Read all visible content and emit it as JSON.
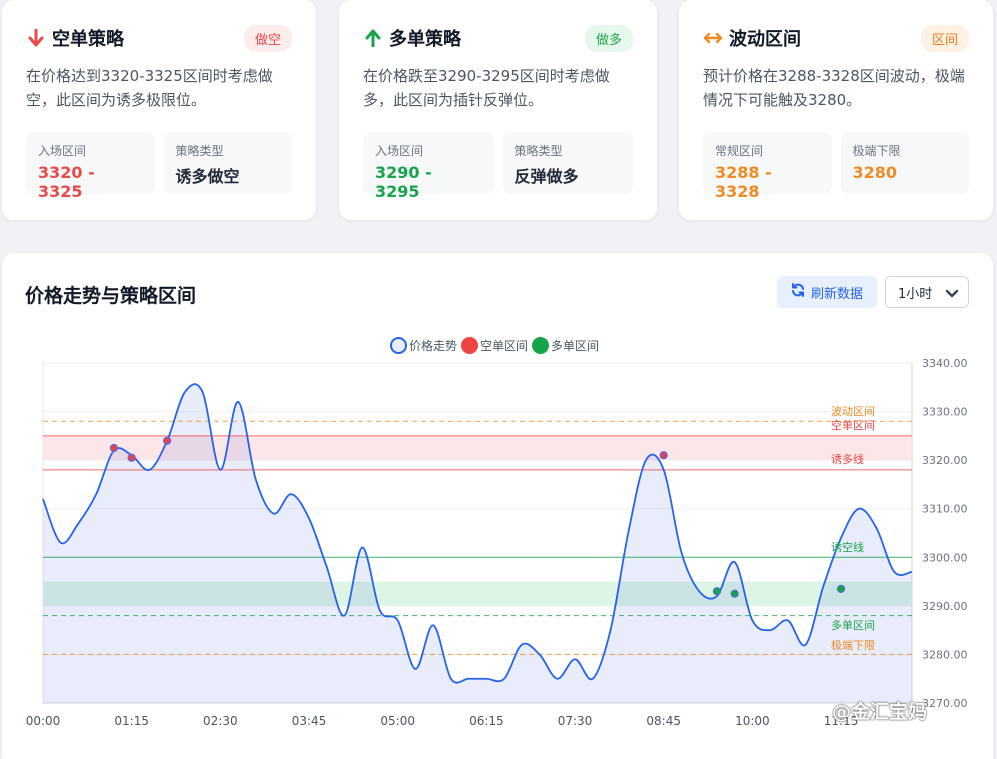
{
  "cards": [
    {
      "title": "空单策略",
      "badge": "做空",
      "badge_bg": "#fdecec",
      "badge_color": "#e84a4a",
      "accent": "#e84a4a",
      "icon": "arrow-down-icon",
      "desc": "在价格达到3320-3325区间时考虑做空，此区间为诱多极限位。",
      "box1_label": "入场区间",
      "box1_value": "3320 - 3325",
      "box2_label": "策略类型",
      "box2_value": "诱多做空"
    },
    {
      "title": "多单策略",
      "badge": "做多",
      "badge_bg": "#e6f7eb",
      "badge_color": "#22a84a",
      "accent": "#16a34a",
      "icon": "arrow-up-icon",
      "desc": "在价格跌至3290-3295区间时考虑做多，此区间为插针反弹位。",
      "box1_label": "入场区间",
      "box1_value": "3290 - 3295",
      "box2_label": "策略类型",
      "box2_value": "反弹做多"
    },
    {
      "title": "波动区间",
      "badge": "区间",
      "badge_bg": "#fff1e3",
      "badge_color": "#ef7d1a",
      "accent": "#f08a24",
      "icon": "arrows-left-right-icon",
      "desc": "预计价格在3288-3328区间波动，极端情况下可能触及3280。",
      "box1_label": "常规区间",
      "box1_value": "3288 - 3328",
      "box2_label": "极端下限",
      "box2_value": "3280"
    }
  ],
  "chart_panel": {
    "title": "价格走势与策略区间",
    "refresh_label": "刷新数据",
    "interval_selected": "1小时"
  },
  "chart_data": {
    "type": "line",
    "legend": [
      "价格走势",
      "空单区间",
      "多单区间"
    ],
    "legend_colors": [
      "#2563eb",
      "#ef4444",
      "#16a34a"
    ],
    "x_tick_labels": [
      "00:00",
      "01:15",
      "02:30",
      "03:45",
      "05:00",
      "06:15",
      "07:30",
      "08:45",
      "10:00",
      "11:15"
    ],
    "x_tick_minutes": [
      0,
      75,
      150,
      225,
      300,
      375,
      450,
      525,
      600,
      675
    ],
    "xlim": [
      0,
      735
    ],
    "ylim": [
      3270,
      3340
    ],
    "y_ticks": [
      3270,
      3280,
      3290,
      3300,
      3310,
      3320,
      3330,
      3340
    ],
    "y_tick_labels": [
      "3270.00",
      "3280.00",
      "3290.00",
      "3300.00",
      "3310.00",
      "3320.00",
      "3330.00",
      "3340.00"
    ],
    "series": [
      {
        "name": "价格走势",
        "color": "#2563eb",
        "x": [
          0,
          15,
          30,
          45,
          60,
          75,
          90,
          105,
          120,
          135,
          150,
          165,
          180,
          195,
          210,
          225,
          240,
          255,
          270,
          285,
          300,
          315,
          330,
          345,
          360,
          375,
          390,
          405,
          420,
          435,
          450,
          465,
          480,
          495,
          510,
          525,
          540,
          555,
          570,
          585,
          600,
          615,
          630,
          645,
          660,
          675,
          690,
          705,
          720,
          735
        ],
        "y": [
          3312,
          3303,
          3307,
          3313,
          3322,
          3321,
          3318,
          3324,
          3334,
          3334,
          3318,
          3332,
          3316,
          3309,
          3313,
          3308,
          3298,
          3288,
          3302,
          3289,
          3287,
          3277,
          3286,
          3275,
          3275,
          3275,
          3275,
          3282,
          3280,
          3275,
          3279,
          3275,
          3285,
          3305,
          3320,
          3318,
          3301,
          3293,
          3292,
          3299,
          3287,
          3285,
          3287,
          3282,
          3294,
          3304,
          3310,
          3306,
          3297,
          3297
        ]
      }
    ],
    "markers": [
      {
        "x": 60,
        "y": 3322.5,
        "zone": "空单区间"
      },
      {
        "x": 75,
        "y": 3320.5,
        "zone": "空单区间"
      },
      {
        "x": 105,
        "y": 3324,
        "zone": "空单区间"
      },
      {
        "x": 525,
        "y": 3321,
        "zone": "空单区间"
      },
      {
        "x": 570,
        "y": 3293,
        "zone": "多单区间"
      },
      {
        "x": 585,
        "y": 3292.5,
        "zone": "多单区间"
      },
      {
        "x": 675,
        "y": 3293.5,
        "zone": "多单区间"
      }
    ],
    "short_zone": [
      3320,
      3325
    ],
    "long_zone": [
      3290,
      3295
    ],
    "reference_lines": [
      {
        "label": "波动区间",
        "value": 3328,
        "color": "#f08a24",
        "dashed": true
      },
      {
        "label": "空单区间",
        "value": 3325,
        "color": "#ef4444",
        "dashed": false
      },
      {
        "label": "诱多线",
        "value": 3318,
        "color": "#ef4444",
        "dashed": false
      },
      {
        "label": "诱空线",
        "value": 3300,
        "color": "#16a34a",
        "dashed": false
      },
      {
        "label": "多单区间",
        "value": 3288,
        "color": "#16a34a",
        "dashed": true
      },
      {
        "label": "极端下限",
        "value": 3280,
        "color": "#f08a24",
        "dashed": true
      }
    ],
    "grid": true
  },
  "watermark": "@金汇宝妈"
}
